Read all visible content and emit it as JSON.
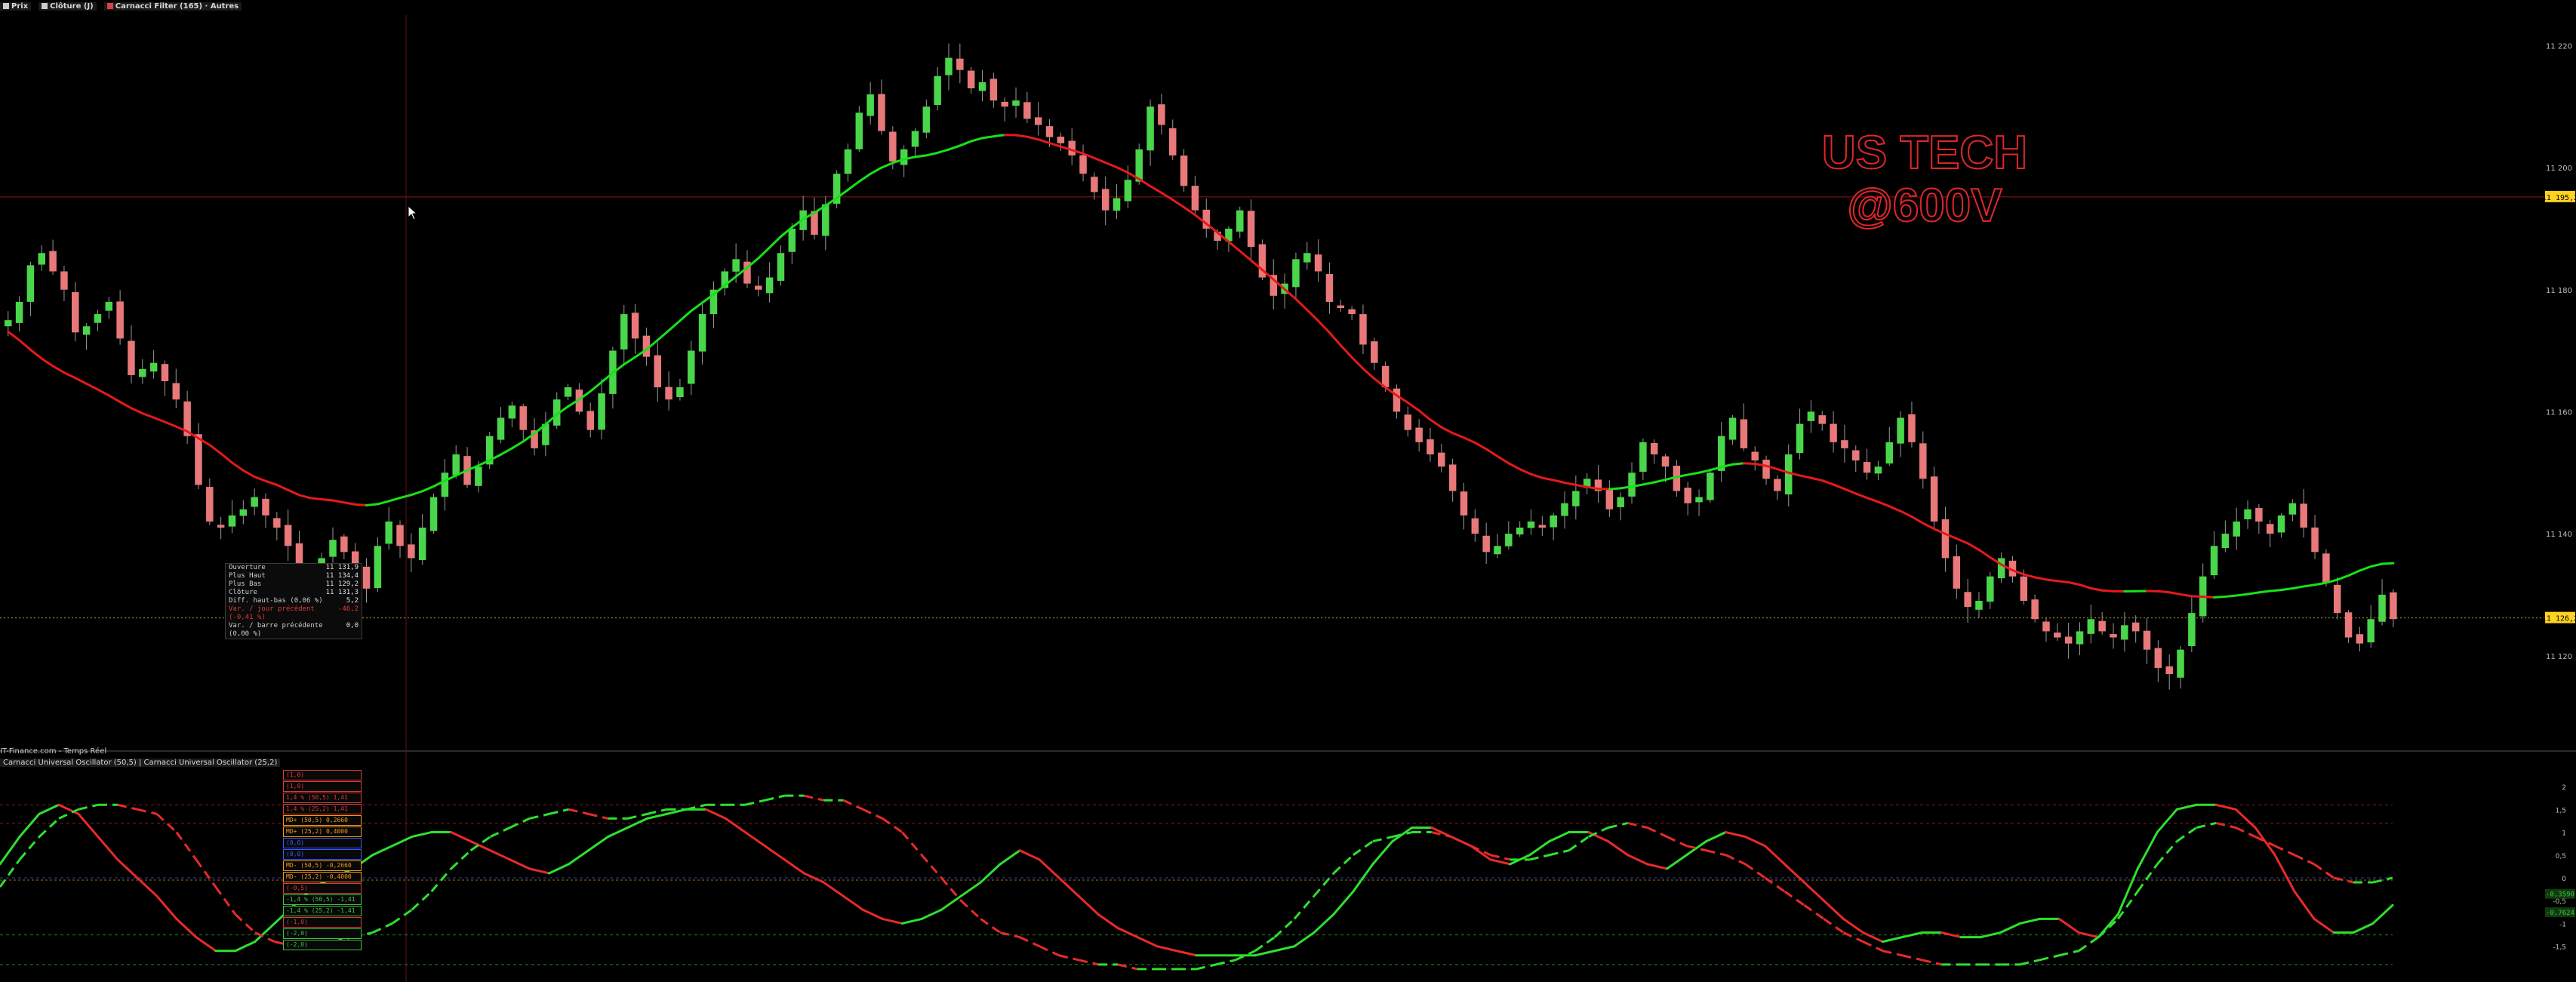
{
  "header": {
    "legend_items": [
      {
        "label": "Prix",
        "color": "#cccccc"
      },
      {
        "label": "Clôture (J)",
        "color": "#cccccc"
      },
      {
        "label": "Carnacci Filter (165) · Autres",
        "color": "#e04040"
      }
    ]
  },
  "watermark": {
    "line1": "US TECH",
    "line2": "@600V"
  },
  "price_axis": {
    "tags": [
      {
        "label": "11 195,2",
        "bg": "#ffd21f",
        "fg": "#000000"
      },
      {
        "label": "11 126,2",
        "bg": "#ffd21f",
        "fg": "#000000"
      }
    ],
    "ticks": [
      "11 220",
      "11 200",
      "11 180",
      "11 160",
      "11 140",
      "11 120"
    ]
  },
  "info_box": {
    "rows": [
      {
        "k": "Ouverture",
        "v": "11 131,9",
        "color": "#cfcfcf"
      },
      {
        "k": "Plus Haut",
        "v": "11 134,4",
        "color": "#cfcfcf"
      },
      {
        "k": "Plus Bas",
        "v": "11 129,2",
        "color": "#cfcfcf"
      },
      {
        "k": "Clôture",
        "v": "11 131,3",
        "color": "#cfcfcf"
      },
      {
        "k": "Diff. haut-bas (0,06 %)",
        "v": "5,2",
        "color": "#cfcfcf"
      },
      {
        "k": "Var. / jour précédent (-0,41 %)",
        "v": "-46,2",
        "color": "#e03a3a"
      },
      {
        "k": "Var. / barre précédente (0,00 %)",
        "v": "0,0",
        "color": "#cfcfcf"
      }
    ]
  },
  "oscillator_pane": {
    "source_line": "IT-Finance.com - Temps Réel",
    "legend": "Carnacci Universal Oscillator (50,5) | Carnacci Universal Oscillator (25,2)",
    "axis_ticks": [
      "2",
      "1,5",
      "1",
      "0,5",
      "0",
      "-0,5",
      "-1",
      "-1,5"
    ],
    "labels": [
      {
        "text": "(1,0)",
        "color": "#e03a3a"
      },
      {
        "text": "(1,0)",
        "color": "#e03a3a"
      },
      {
        "text": "1,4 % (50,5)  1,41",
        "color": "#e03a3a"
      },
      {
        "text": "1,4 % (25,2)  1,41",
        "color": "#e03a3a"
      },
      {
        "text": "MD+ (50,5)  0,2660",
        "color": "#f29a1a"
      },
      {
        "text": "MD+ (25,2)  0,4000",
        "color": "#f29a1a"
      },
      {
        "text": "(0,0)",
        "color": "#3b5bff"
      },
      {
        "text": "(0,0)",
        "color": "#3b5bff"
      },
      {
        "text": "MD- (50,5)  -0,2660",
        "color": "#f29a1a"
      },
      {
        "text": "MD- (25,2)  -0,4000",
        "color": "#f29a1a"
      },
      {
        "text": "(-0,5)",
        "color": "#e03a3a"
      },
      {
        "text": "-1,4 % (50,5) -1,41",
        "color": "#3ec43e"
      },
      {
        "text": "-1,4 % (25,2) -1,41",
        "color": "#3ec43e"
      },
      {
        "text": "(-1,0)",
        "color": "#e03a3a"
      },
      {
        "text": "(-2,0)",
        "color": "#3ec43e"
      },
      {
        "text": "(-2,0)",
        "color": "#3ec43e"
      }
    ],
    "right_tags": [
      {
        "label": "-0,3590",
        "color": "#3ec43e"
      },
      {
        "label": "-0,7624",
        "color": "#3ec43e"
      }
    ]
  },
  "chart_data": [
    {
      "type": "candlestick",
      "ylim": [
        11105,
        11225
      ],
      "colors": {
        "up": "#49d64a",
        "down": "#e8787a",
        "ma_up": "#19e019",
        "ma_down": "#e41a1a"
      },
      "close": [
        11175,
        11178,
        11184,
        11186,
        11183,
        11180,
        11173,
        11174,
        11176,
        11178,
        11172,
        11166,
        11167,
        11168,
        11165,
        11162,
        11156,
        11148,
        11142,
        11141,
        11143,
        11144,
        11146,
        11143,
        11141,
        11138,
        11134,
        11133,
        11136,
        11139,
        11137,
        11134,
        11131,
        11138,
        11142,
        11138,
        11136,
        11141,
        11146,
        11150,
        11153,
        11148,
        11151,
        11156,
        11159,
        11161,
        11157,
        11154,
        11158,
        11162,
        11164,
        11160,
        11157,
        11163,
        11170,
        11176,
        11172,
        11169,
        11164,
        11162,
        11164,
        11170,
        11176,
        11180,
        11183,
        11185,
        11181,
        11180,
        11182,
        11186,
        11190,
        11193,
        11189,
        11194,
        11199,
        11203,
        11209,
        11212,
        11206,
        11201,
        11203,
        11206,
        11210,
        11215,
        11218,
        11216,
        11213,
        11214,
        11211,
        11210,
        11211,
        11208,
        11207,
        11205,
        11204,
        11202,
        11199,
        11196,
        11193,
        11195,
        11198,
        11203,
        11210,
        11207,
        11202,
        11197,
        11193,
        11190,
        11188,
        11190,
        11193,
        11187,
        11182,
        11179,
        11181,
        11185,
        11186,
        11183,
        11178,
        11177,
        11176,
        11171,
        11168,
        11164,
        11160,
        11157,
        11155,
        11153,
        11151,
        11147,
        11143,
        11140,
        11137,
        11138,
        11140,
        11141,
        11142,
        11141,
        11143,
        11145,
        11147,
        11149,
        11147,
        11144,
        11146,
        11150,
        11155,
        11153,
        11151,
        11147,
        11145,
        11146,
        11150,
        11156,
        11159,
        11154,
        11152,
        11149,
        11147,
        11153,
        11158,
        11160,
        11158,
        11155,
        11154,
        11152,
        11150,
        11151,
        11155,
        11159,
        11155,
        11149,
        11142,
        11136,
        11131,
        11128,
        11129,
        11133,
        11136,
        11133,
        11129,
        11126,
        11124,
        11123,
        11122,
        11124,
        11126,
        11124,
        11123,
        11125,
        11124,
        11121,
        11118,
        11117,
        11121,
        11127,
        11133,
        11138,
        11140,
        11142,
        11144,
        11142,
        11140,
        11143,
        11145,
        11141,
        11137,
        11132,
        11127,
        11123,
        11122,
        11126,
        11130,
        11126
      ]
    },
    {
      "type": "line",
      "series": [
        {
          "name": "Carnacci Universal Oscillator (50,5)",
          "style": "solid",
          "values": [
            0.3,
            0.9,
            1.4,
            1.6,
            1.4,
            0.9,
            0.4,
            0.0,
            -0.4,
            -0.9,
            -1.3,
            -1.6,
            -1.6,
            -1.4,
            -1.0,
            -0.6,
            -0.2,
            0.0,
            0.2,
            0.5,
            0.7,
            0.9,
            1.0,
            1.0,
            0.8,
            0.6,
            0.4,
            0.2,
            0.1,
            0.3,
            0.6,
            0.9,
            1.1,
            1.3,
            1.4,
            1.5,
            1.5,
            1.3,
            1.0,
            0.7,
            0.4,
            0.1,
            -0.1,
            -0.4,
            -0.7,
            -0.9,
            -1.0,
            -0.9,
            -0.7,
            -0.4,
            -0.1,
            0.3,
            0.6,
            0.4,
            0.0,
            -0.4,
            -0.8,
            -1.1,
            -1.3,
            -1.5,
            -1.6,
            -1.7,
            -1.7,
            -1.7,
            -1.7,
            -1.6,
            -1.5,
            -1.2,
            -0.8,
            -0.3,
            0.3,
            0.8,
            1.1,
            1.1,
            0.9,
            0.7,
            0.4,
            0.3,
            0.5,
            0.8,
            1.0,
            1.0,
            0.8,
            0.5,
            0.3,
            0.2,
            0.5,
            0.8,
            1.0,
            0.9,
            0.7,
            0.3,
            -0.1,
            -0.5,
            -0.9,
            -1.2,
            -1.4,
            -1.3,
            -1.2,
            -1.2,
            -1.3,
            -1.3,
            -1.2,
            -1.0,
            -0.9,
            -0.9,
            -1.2,
            -1.3,
            -0.8,
            0.2,
            1.0,
            1.5,
            1.6,
            1.6,
            1.5,
            1.1,
            0.5,
            -0.3,
            -0.9,
            -1.2,
            -1.2,
            -1.0,
            -0.6
          ]
        },
        {
          "name": "Carnacci Universal Oscillator (25,2)",
          "style": "dashed",
          "values": [
            -0.2,
            0.4,
            0.9,
            1.3,
            1.5,
            1.6,
            1.6,
            1.5,
            1.4,
            1.0,
            0.4,
            -0.2,
            -0.8,
            -1.2,
            -1.4,
            -1.5,
            -1.5,
            -1.4,
            -1.3,
            -1.2,
            -1.0,
            -0.7,
            -0.3,
            0.2,
            0.6,
            0.9,
            1.1,
            1.3,
            1.4,
            1.5,
            1.4,
            1.3,
            1.3,
            1.4,
            1.5,
            1.5,
            1.6,
            1.6,
            1.6,
            1.7,
            1.8,
            1.8,
            1.7,
            1.7,
            1.5,
            1.3,
            1.0,
            0.5,
            0.0,
            -0.5,
            -0.9,
            -1.2,
            -1.3,
            -1.5,
            -1.7,
            -1.8,
            -1.9,
            -1.9,
            -2.0,
            -2.0,
            -2.0,
            -2.0,
            -1.9,
            -1.8,
            -1.6,
            -1.3,
            -0.9,
            -0.4,
            0.1,
            0.5,
            0.8,
            0.9,
            1.0,
            1.0,
            0.9,
            0.7,
            0.5,
            0.4,
            0.4,
            0.5,
            0.6,
            0.9,
            1.1,
            1.2,
            1.1,
            0.9,
            0.7,
            0.6,
            0.5,
            0.3,
            0.0,
            -0.3,
            -0.6,
            -0.9,
            -1.2,
            -1.4,
            -1.6,
            -1.7,
            -1.8,
            -1.9,
            -1.9,
            -1.9,
            -1.9,
            -1.9,
            -1.8,
            -1.7,
            -1.6,
            -1.3,
            -0.9,
            -0.3,
            0.3,
            0.8,
            1.1,
            1.2,
            1.1,
            0.9,
            0.7,
            0.5,
            0.3,
            0.0,
            -0.1,
            -0.1,
            0.0
          ]
        }
      ],
      "ylim": [
        -2.2,
        2.2
      ]
    }
  ]
}
